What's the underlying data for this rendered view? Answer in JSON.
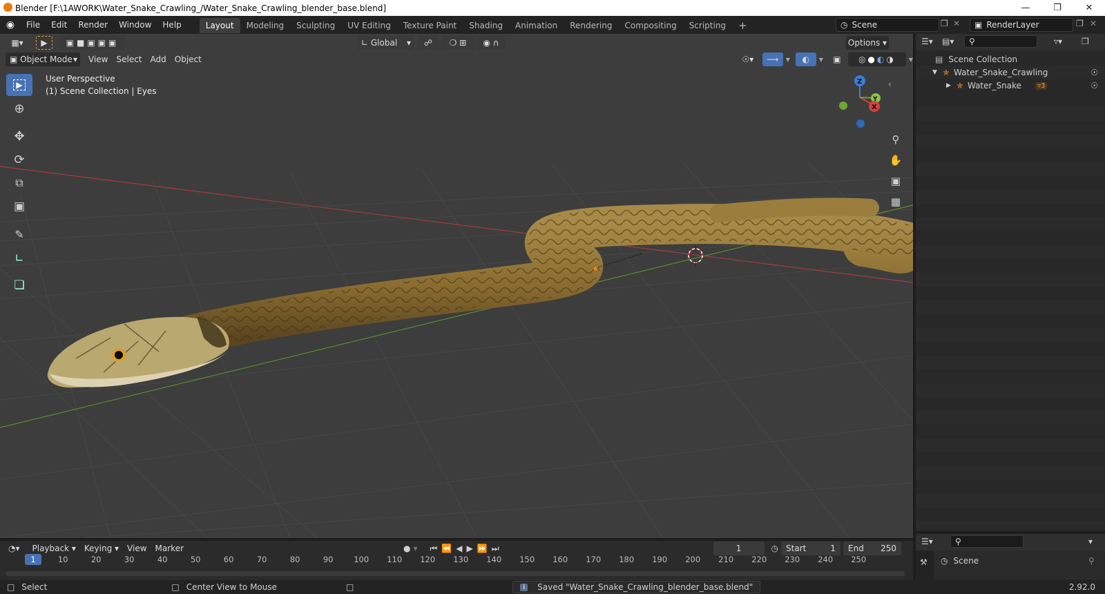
{
  "window": {
    "title": "Blender [F:\\1AWORK\\Water_Snake_Crawling_/Water_Snake_Crawling_blender_base.blend]"
  },
  "menus": [
    "File",
    "Edit",
    "Render",
    "Window",
    "Help"
  ],
  "workspaces": [
    "Layout",
    "Modeling",
    "Sculpting",
    "UV Editing",
    "Texture Paint",
    "Shading",
    "Animation",
    "Rendering",
    "Compositing",
    "Scripting"
  ],
  "active_workspace": "Layout",
  "scene": {
    "label": "Scene",
    "render_layer": "RenderLayer"
  },
  "tool_header": {
    "orientation": "Global",
    "options": "Options"
  },
  "viewport_header": {
    "mode": "Object Mode",
    "view": "View",
    "select": "Select",
    "add": "Add",
    "object": "Object"
  },
  "viewport": {
    "perspective": "User Perspective",
    "collection": "(1) Scene Collection | Eyes"
  },
  "gizmo": {
    "x": "X",
    "y": "Y",
    "z": "Z"
  },
  "outliner": {
    "root": "Scene Collection",
    "items": [
      {
        "label": "Water_Snake_Crawling"
      },
      {
        "label": "Water_Snake",
        "badge": "3"
      }
    ]
  },
  "properties": {
    "scene": "Scene"
  },
  "timeline": {
    "playback": "Playback",
    "keying": "Keying",
    "view": "View",
    "marker": "Marker",
    "current_frame": "1",
    "start_label": "Start",
    "start": "1",
    "end_label": "End",
    "end": "250",
    "ticks": [
      "1",
      "10",
      "20",
      "30",
      "40",
      "50",
      "60",
      "70",
      "80",
      "90",
      "100",
      "110",
      "120",
      "130",
      "140",
      "150",
      "160",
      "170",
      "180",
      "190",
      "200",
      "210",
      "220",
      "230",
      "240",
      "250"
    ]
  },
  "status": {
    "select": "Select",
    "center": "Center View to Mouse",
    "message": "Saved \"Water_Snake_Crawling_blender_base.blend\"",
    "version": "2.92.0"
  }
}
